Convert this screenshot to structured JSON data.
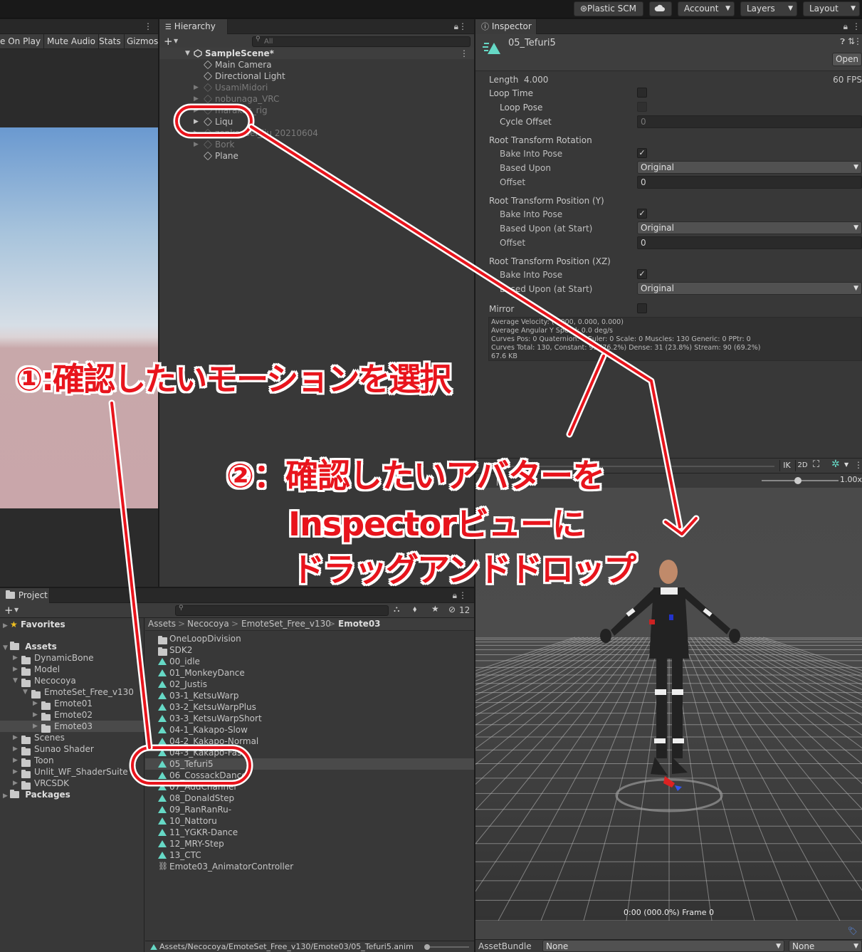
{
  "topbar": {
    "plastic": "⊛Plastic SCM",
    "cloud_icon": "cloud-icon",
    "account": "Account",
    "layers": "Layers",
    "layout": "Layout"
  },
  "game": {
    "toolbar": [
      "e On Play",
      "Mute Audio",
      "Stats",
      "Gizmos"
    ]
  },
  "hierarchy": {
    "tab": "Hierarchy",
    "add": "+",
    "search_placeholder": "All",
    "scene": "SampleScene*",
    "items": [
      {
        "label": "Main Camera",
        "dim": false,
        "expandable": false
      },
      {
        "label": "Directional Light",
        "dim": false,
        "expandable": false
      },
      {
        "label": "UsamiMidori",
        "dim": true,
        "expandable": true
      },
      {
        "label": "nobunaga_VRC",
        "dim": true,
        "expandable": true
      },
      {
        "label": "marakas_rig",
        "dim": true,
        "expandable": true
      },
      {
        "label": "Liqu",
        "dim": false,
        "expandable": true
      },
      {
        "label": "zenkousei_liu 20210604",
        "dim": true,
        "expandable": true
      },
      {
        "label": "Bork",
        "dim": true,
        "expandable": true
      },
      {
        "label": "Plane",
        "dim": false,
        "expandable": false
      }
    ]
  },
  "inspector": {
    "tab": "Inspector",
    "asset_name": "05_Tefuri5",
    "open_label": "Open",
    "length_label": "Length",
    "length_value": "4.000",
    "fps": "60 FPS",
    "loop_time": "Loop Time",
    "loop_pose": "Loop Pose",
    "cycle_offset": "Cycle Offset",
    "cycle_offset_value": "0",
    "rtr_header": "Root Transform Rotation",
    "bake_into_pose": "Bake Into Pose",
    "based_upon": "Based Upon",
    "original": "Original",
    "offset": "Offset",
    "offset_value": "0",
    "rtpy_header": "Root Transform Position (Y)",
    "based_upon_start": "Based Upon (at Start)",
    "rtpxz_header": "Root Transform Position (XZ)",
    "mirror": "Mirror",
    "info": [
      "Average Velocity: (0.000, 0.000, 0.000)",
      "Average Angular Y Speed: 0.0 deg/s",
      "Curves Pos: 0 Quaternion: 0 Euler: 0 Scale: 0 Muscles: 130 Generic: 0 PPtr: 0",
      "Curves Total: 130, Constant: 99 (76.2%) Dense: 31 (23.8%) Stream: 90 (69.2%)",
      "67.6 KB"
    ]
  },
  "preview": {
    "ik": "IK",
    "twod": "2D",
    "speed": "1.00x",
    "frame": "0:00 (000.0%) Frame 0"
  },
  "assetbundle": {
    "label": "AssetBundle",
    "none1": "None",
    "none2": "None"
  },
  "project": {
    "tab": "Project",
    "add": "+",
    "hidden_count": "12",
    "favorites": "Favorites",
    "assets": "Assets",
    "tree": [
      {
        "label": "DynamicBone",
        "depth": 1
      },
      {
        "label": "Model",
        "depth": 1
      },
      {
        "label": "Necocoya",
        "depth": 1
      },
      {
        "label": "EmoteSet_Free_v130",
        "depth": 2
      },
      {
        "label": "Emote01",
        "depth": 3
      },
      {
        "label": "Emote02",
        "depth": 3
      },
      {
        "label": "Emote03",
        "depth": 3
      },
      {
        "label": "Scenes",
        "depth": 1
      },
      {
        "label": "Sunao Shader",
        "depth": 1
      },
      {
        "label": "Toon",
        "depth": 1
      },
      {
        "label": "Unlit_WF_ShaderSuite",
        "depth": 1
      },
      {
        "label": "VRCSDK",
        "depth": 1
      }
    ],
    "packages": "Packages",
    "breadcrumb": [
      "Assets",
      "Necocoya",
      "EmoteSet_Free_v130",
      "Emote03"
    ],
    "files": [
      {
        "label": "OneLoopDivision",
        "kind": "folder"
      },
      {
        "label": "SDK2",
        "kind": "folder"
      },
      {
        "label": "00_idle",
        "kind": "anim"
      },
      {
        "label": "01_MonkeyDance",
        "kind": "anim"
      },
      {
        "label": "02_Justis",
        "kind": "anim"
      },
      {
        "label": "03-1_KetsuWarp",
        "kind": "anim"
      },
      {
        "label": "03-2_KetsuWarpPlus",
        "kind": "anim"
      },
      {
        "label": "03-3_KetsuWarpShort",
        "kind": "anim"
      },
      {
        "label": "04-1_Kakapo-Slow",
        "kind": "anim"
      },
      {
        "label": "04-2_Kakapo-Normal",
        "kind": "anim"
      },
      {
        "label": "04-3_Kakapo-Fast",
        "kind": "anim"
      },
      {
        "label": "05_Tefuri5",
        "kind": "anim"
      },
      {
        "label": "06_CossackDance",
        "kind": "anim"
      },
      {
        "label": "07_AddChannel",
        "kind": "anim"
      },
      {
        "label": "08_DonaldStep",
        "kind": "anim"
      },
      {
        "label": "09_RanRanRu-",
        "kind": "anim"
      },
      {
        "label": "10_Nattoru",
        "kind": "anim"
      },
      {
        "label": "11_YGKR-Dance",
        "kind": "anim"
      },
      {
        "label": "12_MRY-Step",
        "kind": "anim"
      },
      {
        "label": "13_CTC",
        "kind": "anim"
      },
      {
        "label": "Emote03_AnimatorController",
        "kind": "controller"
      }
    ],
    "status_path": "Assets/Necocoya/EmoteSet_Free_v130/Emote03/05_Tefuri5.anim"
  },
  "annotations": {
    "step1": "①:確認したいモーションを選択",
    "step2_line1": "②：確認したいアバターを",
    "step2_line2": "Inspectorビューに",
    "step2_line3": "ドラッグアンドドロップ"
  }
}
